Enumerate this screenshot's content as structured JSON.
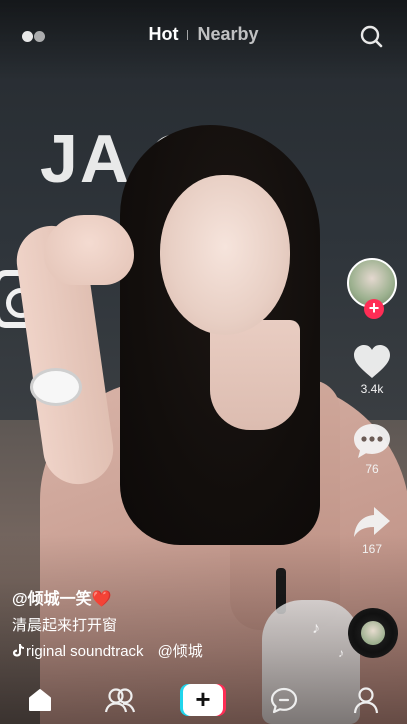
{
  "header": {
    "tabs": [
      {
        "label": "Hot",
        "active": true
      },
      {
        "label": "Nearby",
        "active": false
      }
    ]
  },
  "video": {
    "background_sign_text": "JA  OF"
  },
  "right_rail": {
    "likes": "3.4k",
    "comments": "76",
    "shares": "167"
  },
  "caption": {
    "author": "@倾城一笑❤️",
    "description": "清晨起来打开窗",
    "music_title": "riginal soundtrack",
    "music_author": "@倾城"
  },
  "colors": {
    "accent_pink": "#ff2d55",
    "accent_cyan": "#20d5ec",
    "text": "#ffffff"
  },
  "bottom_nav": {
    "items": [
      "home-icon",
      "friends-icon",
      "create-icon",
      "messages-icon",
      "profile-icon"
    ]
  }
}
